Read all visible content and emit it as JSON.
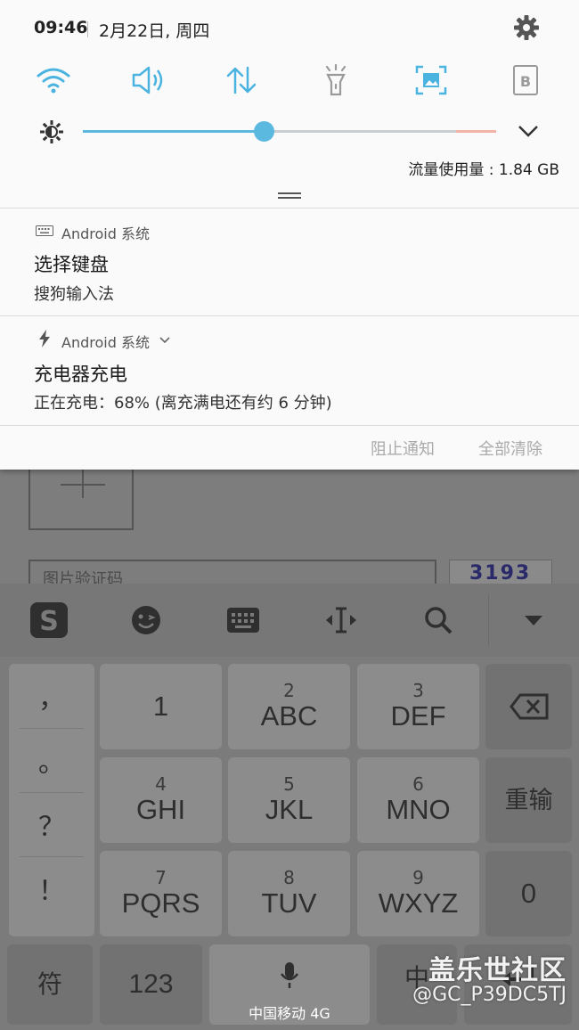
{
  "status_bar": {
    "time": "09:46",
    "date": "2月22日, 周四"
  },
  "quick_settings": {
    "tiles": [
      "wifi-icon",
      "sound-icon",
      "mobile-data-icon",
      "flashlight-icon",
      "screenshot-icon",
      "b-icon"
    ],
    "active_color": "#4ab3e0",
    "inactive_color": "#9a9a9a",
    "brightness_level": 0.44,
    "data_usage": "流量使用量 : 1.84 GB"
  },
  "notifications": [
    {
      "app": "Android 系统",
      "title": "选择键盘",
      "text": "搜狗输入法"
    },
    {
      "app": "Android 系统",
      "title": "充电器充电",
      "text": "正在充电：68% (离充满电还有约 6 分钟)"
    }
  ],
  "shade_actions": {
    "block": "阻止通知",
    "clear_all": "全部清除"
  },
  "background_app": {
    "captcha_placeholder": "图片验证码",
    "captcha_text": "3193"
  },
  "keyboard": {
    "punctuation": [
      "，",
      "。",
      "？",
      "！"
    ],
    "keys": [
      {
        "num": "",
        "label": "1"
      },
      {
        "num": "2",
        "label": "ABC"
      },
      {
        "num": "3",
        "label": "DEF"
      },
      {
        "num": "4",
        "label": "GHI"
      },
      {
        "num": "5",
        "label": "JKL"
      },
      {
        "num": "6",
        "label": "MNO"
      },
      {
        "num": "7",
        "label": "PQRS"
      },
      {
        "num": "8",
        "label": "TUV"
      },
      {
        "num": "9",
        "label": "WXYZ"
      }
    ],
    "reenter": "重输",
    "zero": "0",
    "symbols": "符",
    "numbers": "123",
    "lang": "中"
  },
  "carrier": "中国移动 4G",
  "watermark": {
    "line1": "盖乐世社区",
    "line2": "@GC_P39DC5TJ"
  }
}
